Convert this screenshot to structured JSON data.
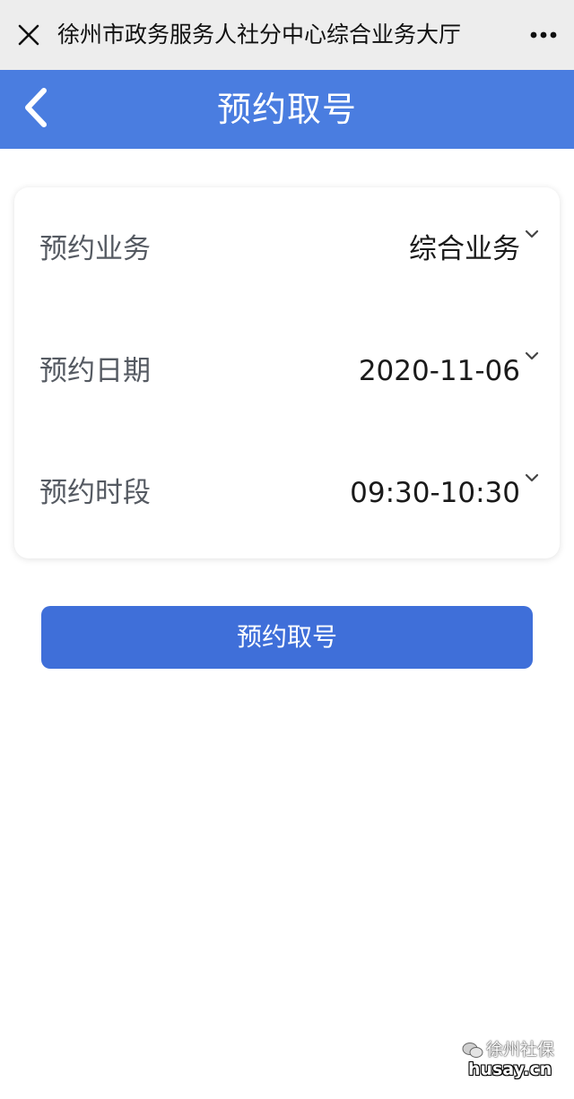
{
  "wechat_bar": {
    "title": "徐州市政务服务人社分中心综合业务大厅",
    "close_icon": "close-icon",
    "more_icon": "more-dots-icon"
  },
  "header": {
    "title": "预约取号",
    "back_icon": "chevron-left-icon",
    "background_color": "#4a7de0"
  },
  "form": {
    "rows": [
      {
        "label": "预约业务",
        "value": "综合业务"
      },
      {
        "label": "预约日期",
        "value": "2020-11-06"
      },
      {
        "label": "预约时段",
        "value": "09:30-10:30"
      }
    ],
    "chevron_icon": "chevron-down-icon"
  },
  "submit_button": {
    "label": "预约取号",
    "color": "#3f6fd9"
  },
  "watermark": {
    "line1": "徐州社保",
    "line2": "husay.cn"
  }
}
